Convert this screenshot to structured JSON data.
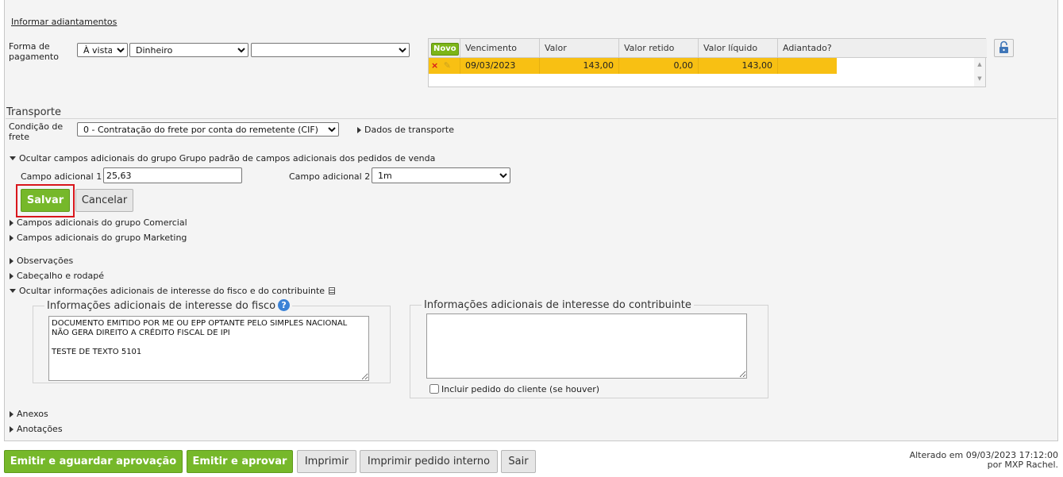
{
  "payment": {
    "section_link": "Informar adiantamentos",
    "forma_label": "Forma de\npagamento",
    "forma_value": "À vista",
    "meio_value": "Dinheiro",
    "extra_value": ""
  },
  "installments": {
    "new_button": "Novo",
    "columns": [
      "Vencimento",
      "Valor",
      "Valor retido",
      "Valor líquido",
      "Adiantado?"
    ],
    "rows": [
      {
        "vencimento": "09/03/2023",
        "valor": "143,00",
        "valor_retido": "0,00",
        "valor_liquido": "143,00",
        "adiantado": ""
      }
    ]
  },
  "transport": {
    "title": "Transporte",
    "condicao_label": "Condição de\nfrete",
    "condicao_value": "0 - Contratação do frete por conta do remetente (CIF)",
    "dados_link": "Dados de transporte"
  },
  "additional": {
    "hide_group_label": "Ocultar campos adicionais do grupo Grupo padrão de campos adicionais dos pedidos de venda",
    "campo1_label": "Campo adicional 1",
    "campo1_value": "25,63",
    "campo2_label": "Campo adicional 2",
    "campo2_value": "1m",
    "save_label": "Salvar",
    "cancel_label": "Cancelar",
    "highlight_color": "#d9161c"
  },
  "collapsibles": {
    "comercial": "Campos adicionais do grupo Comercial",
    "marketing": "Campos adicionais do grupo Marketing",
    "observacoes": "Observações",
    "cabecalho": "Cabeçalho e rodapé",
    "ocultar_info": "Ocultar informações adicionais de interesse do fisco e do contribuinte",
    "anexos": "Anexos",
    "anotacoes": "Anotações"
  },
  "fisco": {
    "legend": "Informações adicionais de interesse do fisco",
    "text": "DOCUMENTO EMITIDO POR ME OU EPP OPTANTE PELO SIMPLES NACIONAL NÃO GERA DIREITO A CRÉDITO FISCAL DE IPI\n\nTESTE DE TEXTO 5101"
  },
  "contribuinte": {
    "legend": "Informações adicionais de interesse do contribuinte",
    "text": "",
    "checkbox_label": "Incluir pedido do cliente (se houver)"
  },
  "footer": {
    "emitir_aguardar": "Emitir e aguardar aprovação",
    "emitir_aprovar": "Emitir e aprovar",
    "imprimir": "Imprimir",
    "imprimir_interno": "Imprimir pedido interno",
    "sair": "Sair",
    "altered_line1": "Alterado em 09/03/2023 17:12:00",
    "altered_line2": "por MXP Rachel."
  },
  "colors": {
    "green": "#76b82a",
    "row_highlight": "#f8c013"
  }
}
